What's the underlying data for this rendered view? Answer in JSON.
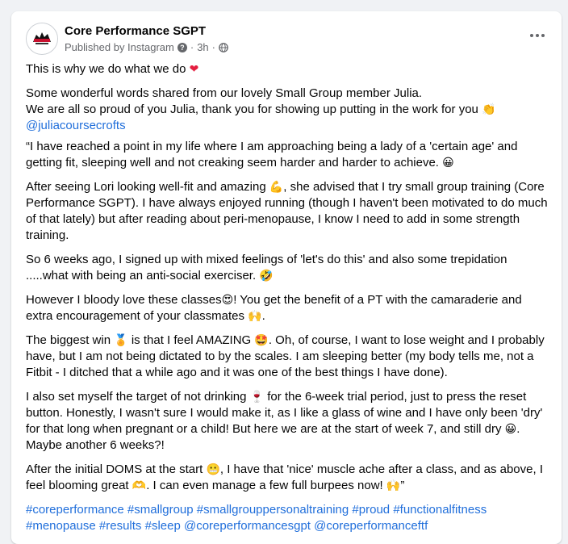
{
  "post": {
    "page_name": "Core Performance SGPT",
    "published_by": "Published by Instagram",
    "dot": "·",
    "time": "3h",
    "p1": "This is why we do what we do",
    "p1_emoji": "❤",
    "p2a": "Some wonderful words shared from our lovely Small Group member Julia.",
    "p2b": "We are all so proud of you Julia, thank you for showing up putting in the work for you",
    "p2b_emoji": "👏",
    "mention1": "@juliacoursecrofts",
    "p3": "“I have reached a point in my life where I am approaching being a lady of a 'certain age' and getting fit, sleeping well and not creaking seem harder and harder to achieve.",
    "p3_emoji": "😀",
    "p4a": "After seeing Lori looking well-fit and amazing",
    "p4_emoji": "💪",
    "p4b": ", she advised that I try small group training (Core Performance SGPT).  I have always enjoyed running  (though I haven't been motivated to do much of that lately) but after reading about peri-menopause, I know I need to add in some strength training.",
    "p5": "So 6 weeks ago, I signed up with mixed feelings of 'let's do this' and also some trepidation .....what with being an anti-social exerciser.",
    "p5_emoji": "🤣",
    "p6a": "However I bloody love these classes",
    "p6_emoji1": "😍",
    "p6b": "!  You get the benefit of a PT with the camaraderie and extra encouragement of your classmates",
    "p6_emoji2": "🙌",
    "p6c": ".",
    "p7a": "The biggest win",
    "p7_emoji1": "🏅",
    "p7b": "is that I feel AMAZING",
    "p7_emoji2": "🤩",
    "p7c": ".  Oh, of course, I want to lose weight and I probably have, but I am not being dictated to by the scales. I am sleeping better (my body tells me, not a Fitbit - I ditched that a while ago and it was one of the best things I have done).",
    "p8a": "I also set myself the target of not drinking",
    "p8_emoji1": "🍷",
    "p8b": "for the 6-week trial period, just to press the reset button. Honestly, I wasn't sure I would make it, as I like a glass of wine and I have only been 'dry' for that long when pregnant or a child!  But here we are at the start of week 7, and still dry",
    "p8_emoji2": "😀",
    "p8c": ".  Maybe another 6 weeks?!",
    "p9a": "After the initial DOMS at the start",
    "p9_emoji1": "😬",
    "p9b": ", I have that 'nice' muscle ache after a class, and as above, I feel blooming great",
    "p9_emoji2": "🫶",
    "p9c": ". I can even manage a few full burpees now!",
    "p9_emoji3": "🙌",
    "p9d": "”",
    "hashtags": [
      "#coreperformance",
      "#smallgroup",
      "#smallgrouppersonaltraining",
      "#proud",
      "#functionalfitness",
      "#menopause",
      "#results",
      "#sleep"
    ],
    "mention2": "@coreperformancesgpt",
    "mention3": "@coreperformanceftf"
  },
  "colors": {
    "link": "#216fdb",
    "meta": "#65676b",
    "background": "#f0f2f5"
  },
  "icons": {
    "more": "more-options-icon",
    "info": "question-icon",
    "privacy": "globe-icon"
  }
}
